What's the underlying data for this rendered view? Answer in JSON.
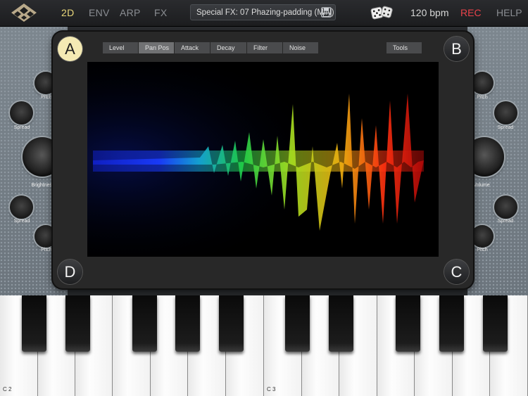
{
  "topbar": {
    "logo": "diamond-logo-icon",
    "nav": [
      "2D",
      "ENV",
      "ARP",
      "FX"
    ],
    "active_nav": "2D",
    "preset": "Special FX: 07 Phazing-padding (MiN)",
    "save_icon": "floppy-disk-icon",
    "dice_icon": "dice-icon",
    "bpm": "120 bpm",
    "rec": "REC",
    "help": "HELP"
  },
  "colors": {
    "accent": "#e9d77a",
    "rec": "#e8424a",
    "pad_active": "#f4eab4"
  },
  "left_knobs": [
    "Pitch",
    "Spread",
    "Brightness",
    "Spread",
    "Pitch"
  ],
  "right_knobs": [
    "Pitch",
    "Spread",
    "Volume",
    "Spread",
    "Pitch"
  ],
  "pad": {
    "corners": [
      "A",
      "B",
      "C",
      "D"
    ],
    "active_corner": "A",
    "tabs": [
      "Level",
      "Pan Pos",
      "Attack",
      "Decay",
      "Filter",
      "Noise"
    ],
    "active_tab": "Pan Pos",
    "tools": "Tools"
  },
  "keyboard": {
    "note_labels": [
      "C 2",
      "C 3"
    ]
  }
}
